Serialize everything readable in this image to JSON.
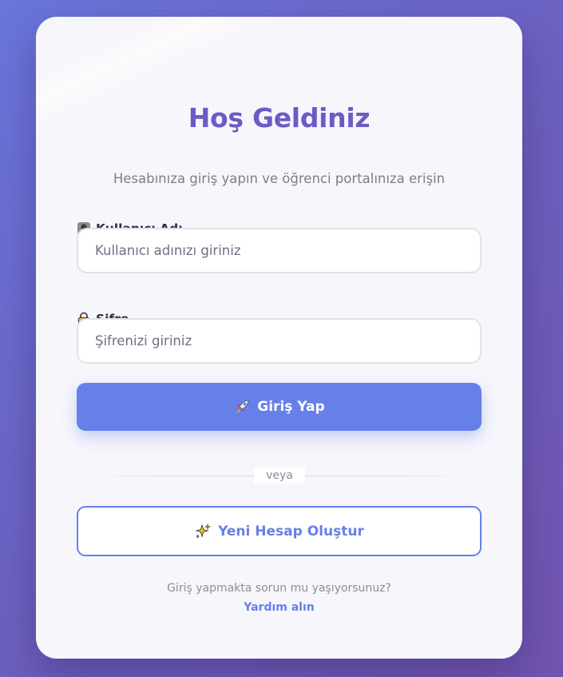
{
  "header": {
    "title": "Hoş Geldiniz",
    "subtitle": "Hesabınıza giriş yapın ve öğrenci portalınıza erişin"
  },
  "form": {
    "username": {
      "icon": "user-icon",
      "label": "Kullanıcı Adı",
      "value": "",
      "placeholder": "Kullanıcı adınızı giriniz"
    },
    "password": {
      "icon": "lock-icon",
      "label": "Şifre",
      "value": "",
      "placeholder": "Şifrenizi giriniz"
    },
    "login_button": {
      "icon": "rocket-icon",
      "label": "Giriş Yap"
    },
    "divider_text": "veya",
    "register_button": {
      "icon": "sparkles-icon",
      "label": "Yeni Hesap Oluştur"
    }
  },
  "footer": {
    "help_text": "Giriş yapmakta sorun mu yaşıyorsunuz?",
    "help_link": "Yardım alın"
  },
  "colors": {
    "accent": "#6680ea",
    "title": "#6a5cc6",
    "background_start": "#6a76dc",
    "background_end": "#7254b0",
    "card": "#f6f6fb"
  }
}
